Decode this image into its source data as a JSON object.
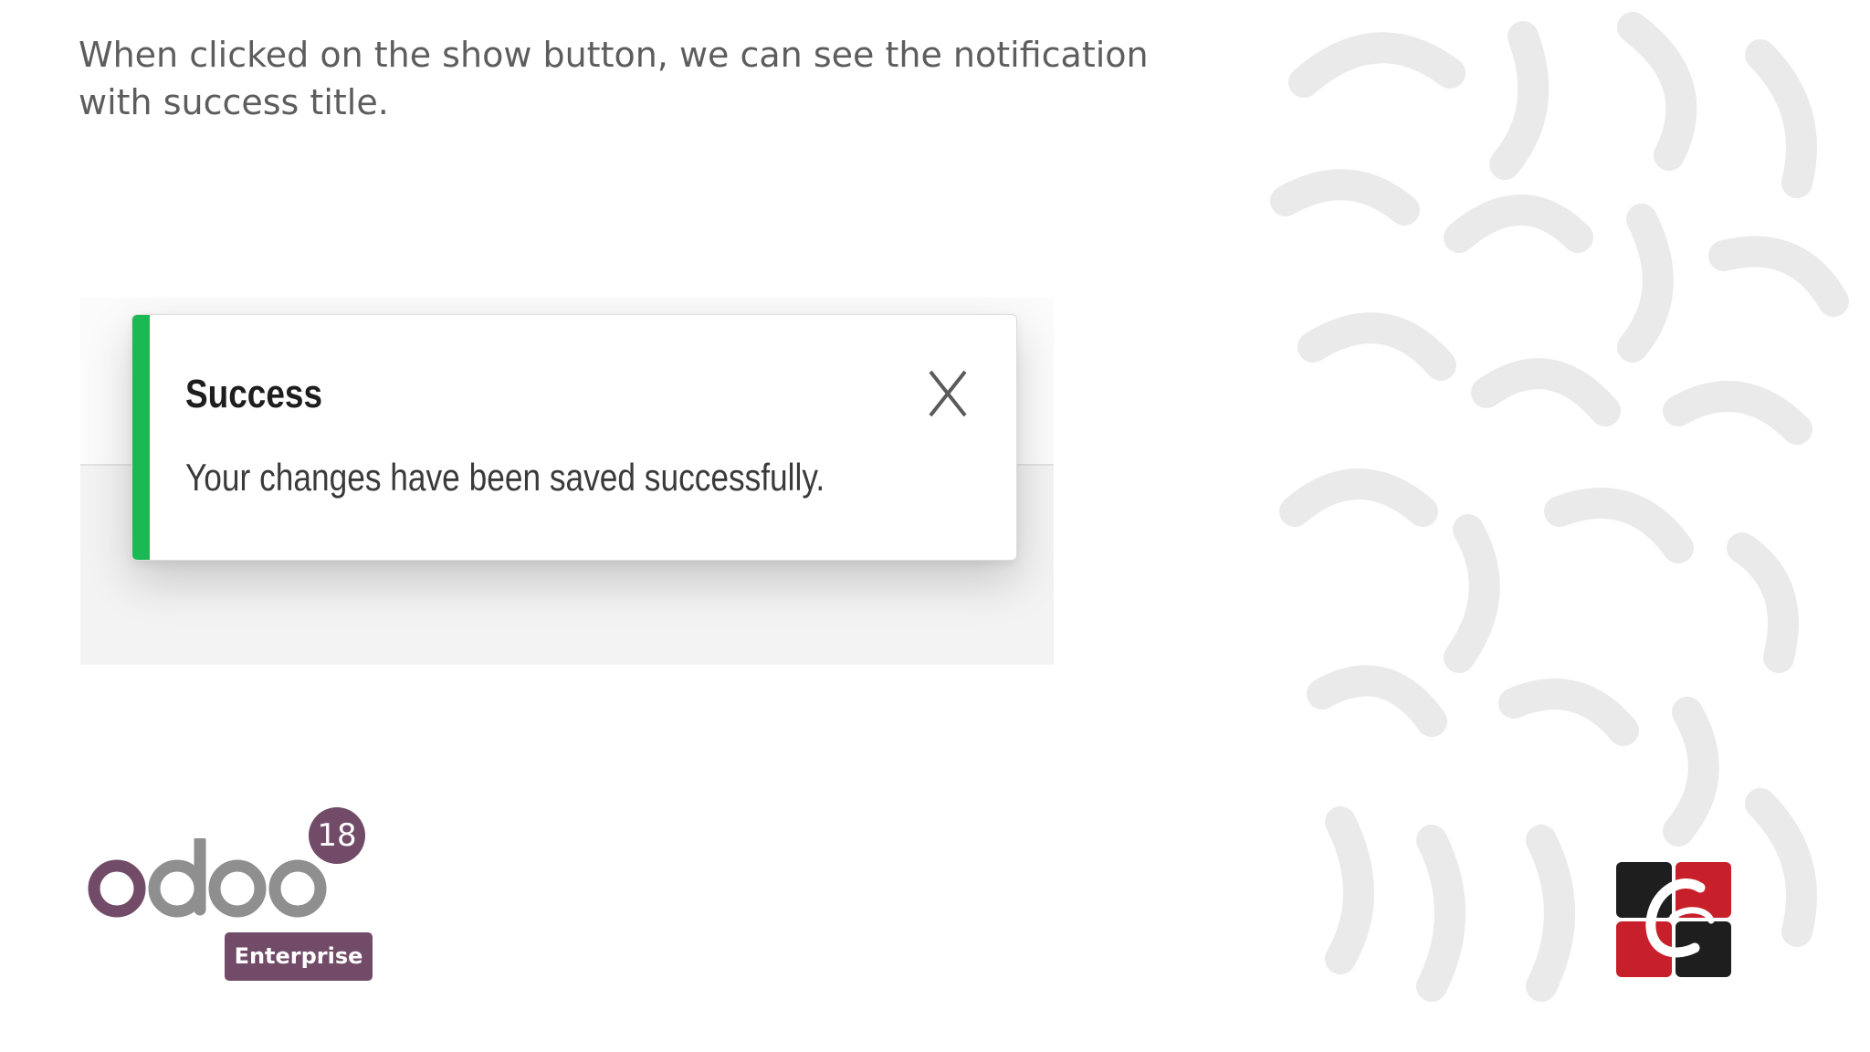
{
  "caption": "When clicked on the show button, we can see the notification with success title.",
  "notification": {
    "title": "Success",
    "message": "Your changes have been saved successfully.",
    "accent_color": "#1bb954",
    "close_icon": "close-icon"
  },
  "branding": {
    "odoo_wordmark": "odoo",
    "version_badge": "18",
    "edition": "Enterprise",
    "brand_color": "#714b67",
    "partner_logo": "cybrosys-logo"
  }
}
